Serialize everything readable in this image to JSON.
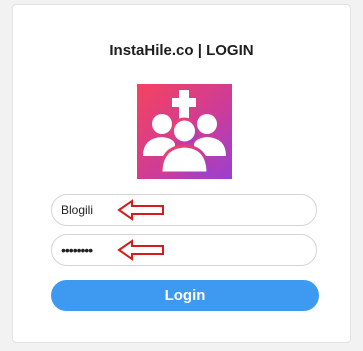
{
  "header": {
    "title": "InstaHile.co | LOGIN"
  },
  "logo": {
    "icon": "group-add-icon",
    "gradient": [
      "#f23a6a",
      "#c63fa6",
      "#9b3fd6"
    ]
  },
  "form": {
    "username_value": "Blogili",
    "password_value": "••••••••",
    "login_label": "Login"
  },
  "annotations": {
    "arrow_color": "#d41c1c",
    "icon": "left-arrow-icon"
  },
  "colors": {
    "button": "#3d9af0"
  }
}
